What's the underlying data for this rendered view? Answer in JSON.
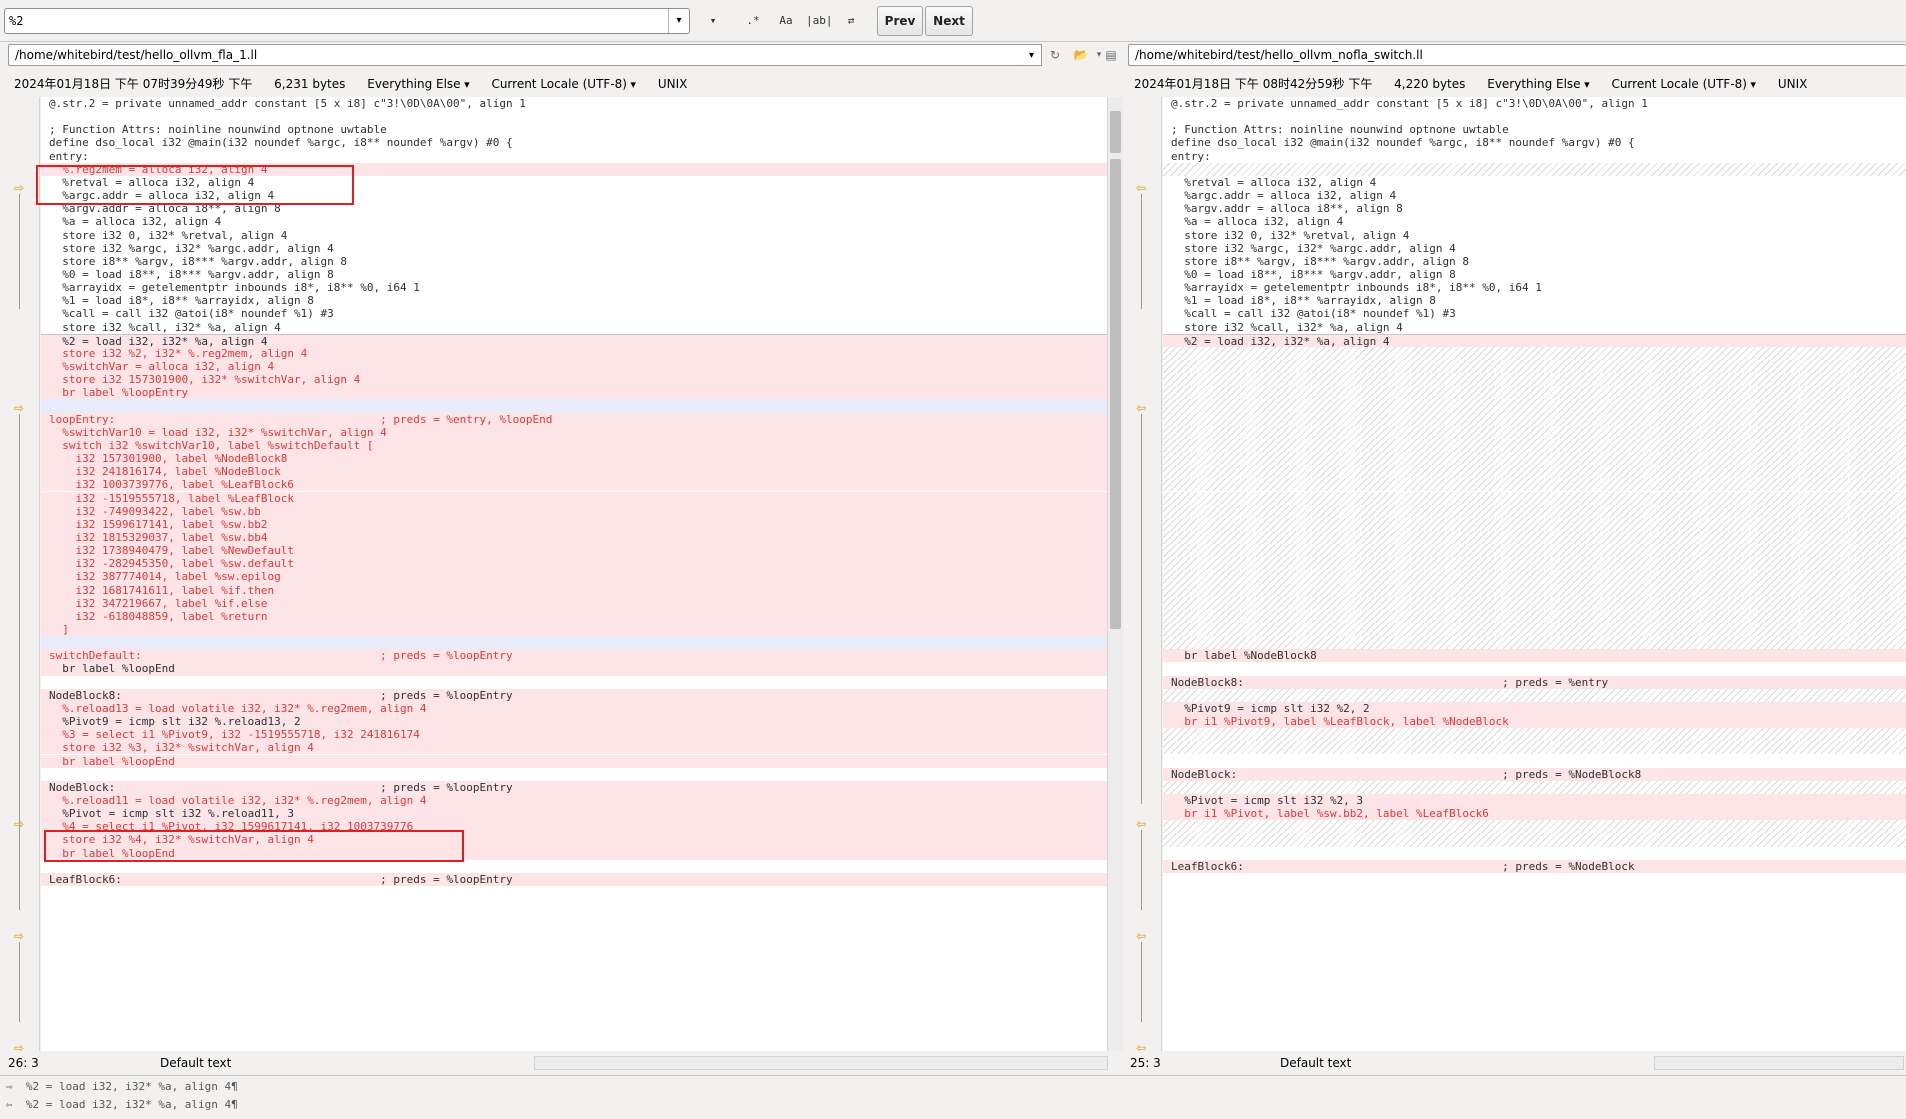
{
  "search": {
    "value": "%2"
  },
  "toolbar": {
    "filter_icon": "▾",
    "regex_label": ".*",
    "case_label": "Aa",
    "word_label": "|ab|",
    "swap_icon": "⇄",
    "prev_label": "Prev",
    "next_label": "Next"
  },
  "left": {
    "path": "/home/whitebird/test/hello_ollvm_fla_1.ll",
    "datetime": "2024年01月18日 下午 07时39分49秒 下午",
    "size": "6,231 bytes",
    "filter": "Everything Else",
    "encoding": "Current Locale (UTF-8)",
    "eol": "UNIX",
    "position": "26: 3",
    "mode": "Default text"
  },
  "right": {
    "path": "/home/whitebird/test/hello_ollvm_nofla_switch.ll",
    "datetime": "2024年01月18日 下午 08时42分59秒 下午",
    "size": "4,220 bytes",
    "filter": "Everything Else",
    "encoding": "Current Locale (UTF-8)",
    "eol": "UNIX",
    "position": "25: 3",
    "mode": "Default text"
  },
  "left_lines": [
    {
      "t": "@.str.2 = private unnamed_addr constant [5 x i8] c\"3!\\0D\\0A\\00\", align 1",
      "k": "n"
    },
    {
      "t": "",
      "k": "n"
    },
    {
      "t": "; Function Attrs: noinline nounwind optnone uwtable",
      "k": "n"
    },
    {
      "t": "define dso_local i32 @main(i32 noundef %argc, i8** noundef %argv) #0 {",
      "k": "n"
    },
    {
      "t": "entry:",
      "k": "n"
    },
    {
      "t": "  %.reg2mem = alloca i32, align 4",
      "k": "a"
    },
    {
      "t": "  %retval = alloca i32, align 4",
      "k": "n"
    },
    {
      "t": "  %argc.addr = alloca i32, align 4",
      "k": "n"
    },
    {
      "t": "  %argv.addr = alloca i8**, align 8",
      "k": "n"
    },
    {
      "t": "  %a = alloca i32, align 4",
      "k": "n"
    },
    {
      "t": "  store i32 0, i32* %retval, align 4",
      "k": "n"
    },
    {
      "t": "  store i32 %argc, i32* %argc.addr, align 4",
      "k": "n"
    },
    {
      "t": "  store i8** %argv, i8*** %argv.addr, align 8",
      "k": "n"
    },
    {
      "t": "  %0 = load i8**, i8*** %argv.addr, align 8",
      "k": "n"
    },
    {
      "t": "  %arrayidx = getelementptr inbounds i8*, i8** %0, i64 1",
      "k": "n"
    },
    {
      "t": "  %1 = load i8*, i8** %arrayidx, align 8",
      "k": "n"
    },
    {
      "t": "  %call = call i32 @atoi(i8* noundef %1) #3",
      "k": "n"
    },
    {
      "t": "  store i32 %call, i32* %a, align 4",
      "k": "n"
    },
    {
      "t": "  %2 = load i32, i32* %a, align 4",
      "k": "c"
    },
    {
      "t": "  store i32 %2, i32* %.reg2mem, align 4",
      "k": "a"
    },
    {
      "t": "  %switchVar = alloca i32, align 4",
      "k": "a"
    },
    {
      "t": "  store i32 157301900, i32* %switchVar, align 4",
      "k": "a"
    },
    {
      "t": "  br label %loopEntry",
      "k": "a"
    },
    {
      "t": "",
      "k": "s"
    },
    {
      "t": "loopEntry:                                        ; preds = %entry, %loopEnd",
      "k": "a"
    },
    {
      "t": "  %switchVar10 = load i32, i32* %switchVar, align 4",
      "k": "a"
    },
    {
      "t": "  switch i32 %switchVar10, label %switchDefault [",
      "k": "a"
    },
    {
      "t": "    i32 157301900, label %NodeBlock8",
      "k": "a"
    },
    {
      "t": "    i32 241816174, label %NodeBlock",
      "k": "a"
    },
    {
      "t": "    i32 1003739776, label %LeafBlock6",
      "k": "a"
    },
    {
      "t": "    i32 -1519555718, label %LeafBlock",
      "k": "a"
    },
    {
      "t": "    i32 -749093422, label %sw.bb",
      "k": "a"
    },
    {
      "t": "    i32 1599617141, label %sw.bb2",
      "k": "a"
    },
    {
      "t": "    i32 1815329037, label %sw.bb4",
      "k": "a"
    },
    {
      "t": "    i32 1738940479, label %NewDefault",
      "k": "a"
    },
    {
      "t": "    i32 -282945350, label %sw.default",
      "k": "a"
    },
    {
      "t": "    i32 387774014, label %sw.epilog",
      "k": "a"
    },
    {
      "t": "    i32 1681741611, label %if.then",
      "k": "a"
    },
    {
      "t": "    i32 347219667, label %if.else",
      "k": "a"
    },
    {
      "t": "    i32 -618048859, label %return",
      "k": "a"
    },
    {
      "t": "  ]",
      "k": "a"
    },
    {
      "t": "",
      "k": "s"
    },
    {
      "t": "switchDefault:                                    ; preds = %loopEntry",
      "k": "a"
    },
    {
      "t": "  br label %loopEnd",
      "k": "c"
    },
    {
      "t": "",
      "k": "n"
    },
    {
      "t": "NodeBlock8:                                       ; preds = %loopEntry",
      "k": "c"
    },
    {
      "t": "  %.reload13 = load volatile i32, i32* %.reg2mem, align 4",
      "k": "a"
    },
    {
      "t": "  %Pivot9 = icmp slt i32 %.reload13, 2",
      "k": "c"
    },
    {
      "t": "  %3 = select i1 %Pivot9, i32 -1519555718, i32 241816174",
      "k": "a"
    },
    {
      "t": "  store i32 %3, i32* %switchVar, align 4",
      "k": "a"
    },
    {
      "t": "  br label %loopEnd",
      "k": "a"
    },
    {
      "t": "",
      "k": "n"
    },
    {
      "t": "NodeBlock:                                        ; preds = %loopEntry",
      "k": "c"
    },
    {
      "t": "  %.reload11 = load volatile i32, i32* %.reg2mem, align 4",
      "k": "a"
    },
    {
      "t": "  %Pivot = icmp slt i32 %.reload11, 3",
      "k": "c"
    },
    {
      "t": "  %4 = select i1 %Pivot, i32 1599617141, i32 1003739776",
      "k": "a"
    },
    {
      "t": "  store i32 %4, i32* %switchVar, align 4",
      "k": "a"
    },
    {
      "t": "  br label %loopEnd",
      "k": "a"
    },
    {
      "t": "",
      "k": "n"
    },
    {
      "t": "LeafBlock6:                                       ; preds = %loopEntry",
      "k": "c"
    }
  ],
  "right_lines": [
    {
      "t": "@.str.2 = private unnamed_addr constant [5 x i8] c\"3!\\0D\\0A\\00\", align 1",
      "k": "n"
    },
    {
      "t": "",
      "k": "n"
    },
    {
      "t": "; Function Attrs: noinline nounwind optnone uwtable",
      "k": "n"
    },
    {
      "t": "define dso_local i32 @main(i32 noundef %argc, i8** noundef %argv) #0 {",
      "k": "n"
    },
    {
      "t": "entry:",
      "k": "n"
    },
    {
      "t": "",
      "k": "g"
    },
    {
      "t": "  %retval = alloca i32, align 4",
      "k": "n"
    },
    {
      "t": "  %argc.addr = alloca i32, align 4",
      "k": "n"
    },
    {
      "t": "  %argv.addr = alloca i8**, align 8",
      "k": "n"
    },
    {
      "t": "  %a = alloca i32, align 4",
      "k": "n"
    },
    {
      "t": "  store i32 0, i32* %retval, align 4",
      "k": "n"
    },
    {
      "t": "  store i32 %argc, i32* %argc.addr, align 4",
      "k": "n"
    },
    {
      "t": "  store i8** %argv, i8*** %argv.addr, align 8",
      "k": "n"
    },
    {
      "t": "  %0 = load i8**, i8*** %argv.addr, align 8",
      "k": "n"
    },
    {
      "t": "  %arrayidx = getelementptr inbounds i8*, i8** %0, i64 1",
      "k": "n"
    },
    {
      "t": "  %1 = load i8*, i8** %arrayidx, align 8",
      "k": "n"
    },
    {
      "t": "  %call = call i32 @atoi(i8* noundef %1) #3",
      "k": "n"
    },
    {
      "t": "  store i32 %call, i32* %a, align 4",
      "k": "n"
    },
    {
      "t": "  %2 = load i32, i32* %a, align 4",
      "k": "c"
    },
    {
      "t": "",
      "k": "g"
    },
    {
      "t": "",
      "k": "g"
    },
    {
      "t": "",
      "k": "g"
    },
    {
      "t": "",
      "k": "g"
    },
    {
      "t": "",
      "k": "g"
    },
    {
      "t": "",
      "k": "g"
    },
    {
      "t": "",
      "k": "g"
    },
    {
      "t": "",
      "k": "g"
    },
    {
      "t": "",
      "k": "g"
    },
    {
      "t": "",
      "k": "g"
    },
    {
      "t": "",
      "k": "g"
    },
    {
      "t": "",
      "k": "g"
    },
    {
      "t": "",
      "k": "g"
    },
    {
      "t": "",
      "k": "g"
    },
    {
      "t": "",
      "k": "g"
    },
    {
      "t": "",
      "k": "g"
    },
    {
      "t": "",
      "k": "g"
    },
    {
      "t": "",
      "k": "g"
    },
    {
      "t": "",
      "k": "g"
    },
    {
      "t": "",
      "k": "g"
    },
    {
      "t": "",
      "k": "g"
    },
    {
      "t": "",
      "k": "g"
    },
    {
      "t": "",
      "k": "g"
    },
    {
      "t": "  br label %NodeBlock8",
      "k": "c"
    },
    {
      "t": "",
      "k": "n"
    },
    {
      "t": "NodeBlock8:                                       ; preds = %entry",
      "k": "c"
    },
    {
      "t": "",
      "k": "g"
    },
    {
      "t": "  %Pivot9 = icmp slt i32 %2, 2",
      "k": "c"
    },
    {
      "t": "  br i1 %Pivot9, label %LeafBlock, label %NodeBlock",
      "k": "a"
    },
    {
      "t": "",
      "k": "g"
    },
    {
      "t": "",
      "k": "g"
    },
    {
      "t": "",
      "k": "n"
    },
    {
      "t": "NodeBlock:                                        ; preds = %NodeBlock8",
      "k": "c"
    },
    {
      "t": "",
      "k": "g"
    },
    {
      "t": "  %Pivot = icmp slt i32 %2, 3",
      "k": "c"
    },
    {
      "t": "  br i1 %Pivot, label %sw.bb2, label %LeafBlock6",
      "k": "a"
    },
    {
      "t": "",
      "k": "g"
    },
    {
      "t": "",
      "k": "g"
    },
    {
      "t": "",
      "k": "n"
    },
    {
      "t": "LeafBlock6:                                       ; preds = %NodeBlock",
      "k": "c"
    }
  ],
  "bottom": {
    "left_line": "  %2 = load i32, i32* %a, align 4",
    "right_line": "  %2 = load i32, i32* %a, align 4",
    "eol_mark": "¶"
  },
  "icons": {
    "arrow": "⇨",
    "arrow_left": "⇦",
    "dropdown": "▾",
    "open_folder": "📂",
    "save": "▤",
    "reload": "↻"
  }
}
